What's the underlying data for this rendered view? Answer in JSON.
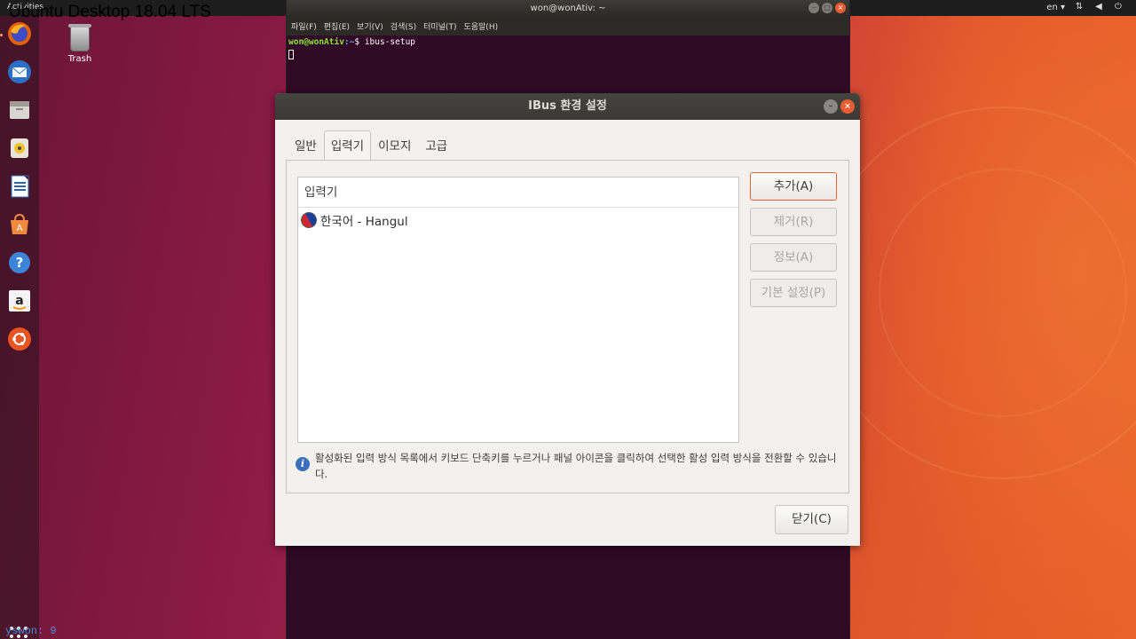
{
  "overlay_title": "Ubuntu Desktop 18.04 LTS",
  "top_panel": {
    "activities": "Activities",
    "lang": "en ▾"
  },
  "desktop": {
    "trash_label": "Trash"
  },
  "dock": {
    "items": [
      "firefox-icon",
      "thunderbird-icon",
      "files-icon",
      "rhythmbox-icon",
      "writer-icon",
      "software-icon",
      "help-icon",
      "amazon-icon",
      "ubuntu-icon"
    ]
  },
  "footer_text": "yswon:  9",
  "terminal": {
    "title": "won@wonAtiv: ~",
    "menu": [
      "파일(F)",
      "편집(E)",
      "보기(V)",
      "검색(S)",
      "터미널(T)",
      "도움말(H)"
    ],
    "prompt_user": "won@wonAtiv",
    "prompt_path": ":~",
    "command": "$ ibus-setup"
  },
  "dialog": {
    "title": "IBus 환경 설정",
    "tabs": [
      "일반",
      "입력기",
      "이모지",
      "고급"
    ],
    "active_tab": "입력기",
    "list_header": "입력기",
    "input_methods": [
      {
        "label": "한국어 - Hangul",
        "icon": "taeguk-icon"
      }
    ],
    "buttons": {
      "add": "추가(A)",
      "remove": "제거(R)",
      "about": "정보(A)",
      "preferences": "기본 설정(P)"
    },
    "info_text": "활성화된 입력 방식 목록에서 키보드 단축키를 누르거나 패널 아이콘을 클릭하여 선택한 활성 입력 방식을 전환할 수 있습니다.",
    "close": "닫기(C)"
  }
}
